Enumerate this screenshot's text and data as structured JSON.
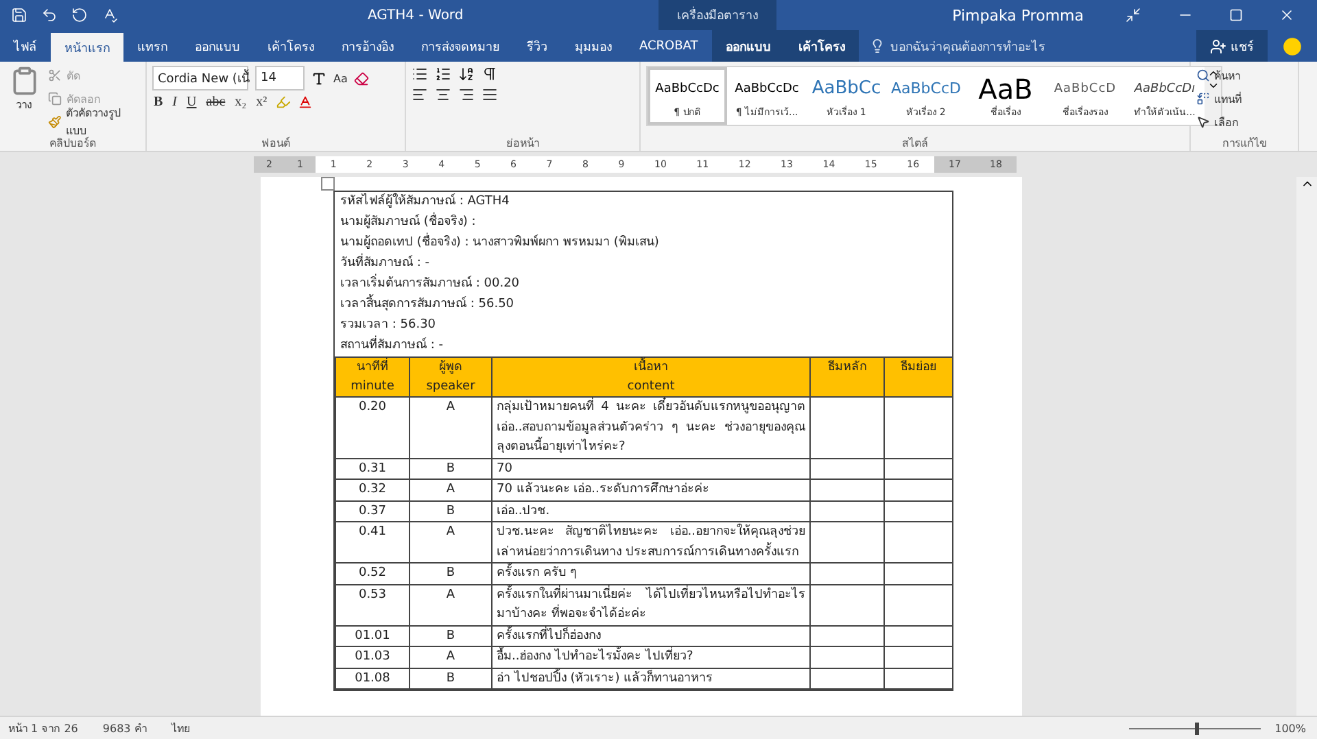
{
  "title_bar": {
    "title": "AGTH4 - Word",
    "context_label": "เครื่องมือตาราง",
    "user": "Pimpaka Promma"
  },
  "tabs": [
    {
      "label": "ไฟล์",
      "selected": false,
      "kind": "file"
    },
    {
      "label": "หน้าแรก",
      "selected": true,
      "kind": "normal"
    },
    {
      "label": "แทรก",
      "selected": false,
      "kind": "normal"
    },
    {
      "label": "ออกแบบ",
      "selected": false,
      "kind": "normal"
    },
    {
      "label": "เค้าโครง",
      "selected": false,
      "kind": "normal"
    },
    {
      "label": "การอ้างอิง",
      "selected": false,
      "kind": "normal"
    },
    {
      "label": "การส่งจดหมาย",
      "selected": false,
      "kind": "normal"
    },
    {
      "label": "รีวิว",
      "selected": false,
      "kind": "normal"
    },
    {
      "label": "มุมมอง",
      "selected": false,
      "kind": "normal"
    },
    {
      "label": "ACROBAT",
      "selected": false,
      "kind": "normal"
    },
    {
      "label": "ออกแบบ",
      "selected": false,
      "kind": "context"
    },
    {
      "label": "เค้าโครง",
      "selected": false,
      "kind": "context"
    }
  ],
  "tell_me": {
    "placeholder": "บอกฉันว่าคุณต้องการทำอะไร"
  },
  "share": "แชร์",
  "clipboard": {
    "paste": "วาง",
    "cut": "ตัด",
    "copy": "คัดลอก",
    "format_painter": "ตัวคัดวางรูปแบบ",
    "label": "คลิปบอร์ด"
  },
  "font": {
    "name": "Cordia New (เนื้",
    "size": "14",
    "case": "Aa",
    "format_buttons": [
      "B",
      "I",
      "U",
      "abc",
      "x₂",
      "x²"
    ],
    "label": "ฟอนต์"
  },
  "paragraph": {
    "label": "ย่อหน้า"
  },
  "styles": {
    "label": "สไตล์",
    "items": [
      {
        "preview": "AaBbCcDc",
        "name": "¶ ปกติ",
        "kind": "normal",
        "selected": true
      },
      {
        "preview": "AaBbCcDc",
        "name": "¶ ไม่มีการเว้...",
        "kind": "normal",
        "selected": false
      },
      {
        "preview": "AaBbCc",
        "name": "หัวเรื่อง 1",
        "kind": "heading1",
        "selected": false
      },
      {
        "preview": "AaBbCcD",
        "name": "หัวเรื่อง 2",
        "kind": "heading2",
        "selected": false
      },
      {
        "preview": "AaB",
        "name": "ชื่อเรื่อง",
        "kind": "title",
        "selected": false
      },
      {
        "preview": "AaBbCcD",
        "name": "ชื่อเรื่องรอง",
        "kind": "subtitle",
        "selected": false
      },
      {
        "preview": "AaBbCcDı",
        "name": "ทำให้ตัวเน้น...",
        "kind": "emphasis",
        "selected": false
      }
    ]
  },
  "editing": {
    "find": "ค้นหา",
    "replace": "แทนที่",
    "select": "เลือก",
    "label": "การแก้ไข"
  },
  "ruler": {
    "left_numbers": [
      "2",
      "1"
    ],
    "numbers": [
      "1",
      "2",
      "3",
      "4",
      "5",
      "6",
      "7",
      "8",
      "9",
      "10",
      "11",
      "12",
      "13",
      "14",
      "15",
      "16",
      "17",
      "18"
    ]
  },
  "document": {
    "header_lines": [
      "รหัสไฟล์ผู้ให้สัมภาษณ์ : AGTH4",
      "นามผู้สัมภาษณ์ (ชื่อจริง) :",
      "นามผู้ถอดเทป (ชื่อจริง) : นางสาวพิมพ์ผกา พรหมมา (พิมเสน)",
      "วันที่สัมภาษณ์ : -",
      "เวลาเริ่มต้นการสัมภาษณ์ : 00.20",
      "เวลาสิ้นสุดการสัมภาษณ์ : 56.50",
      "รวมเวลา : 56.30",
      "สถานที่สัมภาษณ์ : -"
    ],
    "columns": [
      {
        "line1": "นาทีที่",
        "line2": "minute"
      },
      {
        "line1": "ผู้พูด",
        "line2": "speaker"
      },
      {
        "line1": "เนื้อหา",
        "line2": "content"
      },
      {
        "line1": "ธีมหลัก"
      },
      {
        "line1": "ธีมย่อย"
      }
    ],
    "rows": [
      {
        "minute": "0.20",
        "speaker": "A",
        "content": "กลุ่มเป้าหมายคนที่ 4 นะคะ เดี๋ยวอันดับแรกหนูขออนุญาต เอ่อ..สอบถามข้อมูลส่วนตัวคร่าว ๆ นะคะ ช่วงอายุของคุณลุงตอนนี้อายุเท่าไหร่คะ?"
      },
      {
        "minute": "0.31",
        "speaker": "B",
        "content": "70"
      },
      {
        "minute": "0.32",
        "speaker": "A",
        "content": "70 แล้วนะคะ เอ่อ..ระดับการศึกษาอ่ะค่ะ"
      },
      {
        "minute": "0.37",
        "speaker": "B",
        "content": "เอ่อ..ปวช."
      },
      {
        "minute": "0.41",
        "speaker": "A",
        "content": "ปวช.นะคะ สัญชาติไทยนะคะ เอ่อ..อยากจะให้คุณลุงช่วยเล่าหน่อยว่าการเดินทาง ประสบการณ์การเดินทางครั้งแรก"
      },
      {
        "minute": "0.52",
        "speaker": "B",
        "content": "ครั้งแรก ครับ ๆ"
      },
      {
        "minute": "0.53",
        "speaker": "A",
        "content": "ครั้งแรกในที่ผ่านมาเนี่ยค่ะ ได้ไปเที่ยวไหนหรือไปทำอะไรมาบ้างคะ ที่พอจะจำได้อ่ะค่ะ"
      },
      {
        "minute": "01.01",
        "speaker": "B",
        "content": "ครั้งแรกที่ไปก็ฮ่องกง"
      },
      {
        "minute": "01.03",
        "speaker": "A",
        "content": "อื้ม..ฮ่องกง ไปทำอะไรมั้งคะ ไปเที่ยว?"
      },
      {
        "minute": "01.08",
        "speaker": "B",
        "content": "อ่า ไปชอปปิ้ง (หัวเราะ) แล้วก็ทานอาหาร"
      }
    ]
  },
  "status_bar": {
    "page": "หน้า 1 จาก 26",
    "words": "9683 คำ",
    "language": "ไทย",
    "zoom": "100%",
    "zoom_slider": {
      "level": 0.5
    }
  }
}
